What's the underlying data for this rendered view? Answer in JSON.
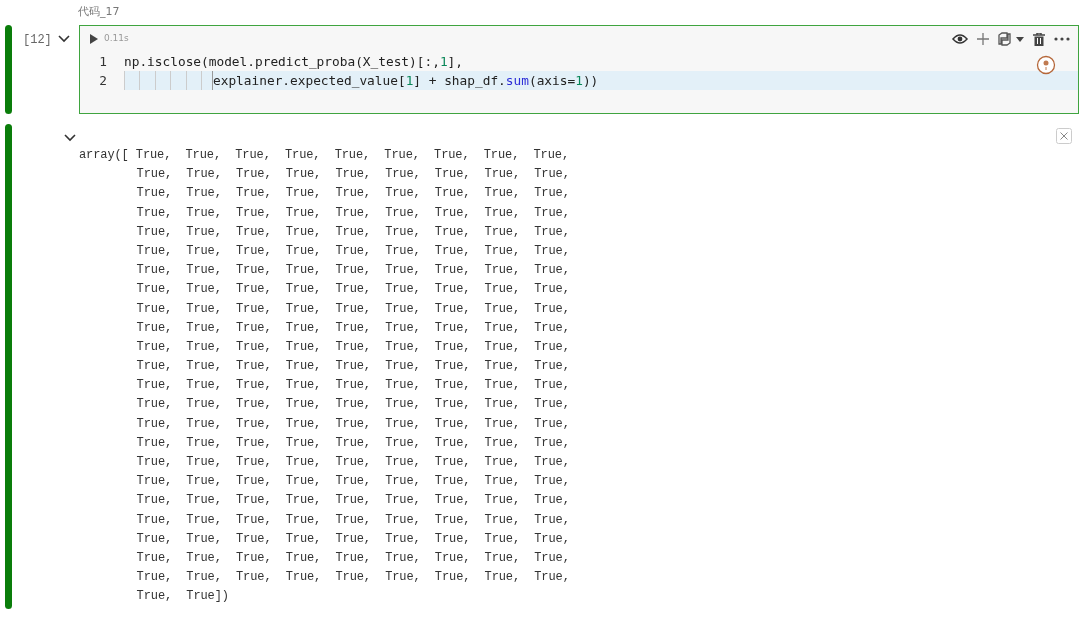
{
  "cell_title": "代码_17",
  "code_cell": {
    "execution_count": "[12]",
    "expanded": true,
    "run_time": "0.11s",
    "lines": [
      {
        "number": "1",
        "current": false,
        "tokens": [
          {
            "kind": "plain",
            "text": "np.isclose(model.predict_proba(X_test)[:,"
          },
          {
            "kind": "number",
            "text": "1"
          },
          {
            "kind": "plain",
            "text": "],"
          }
        ]
      },
      {
        "number": "2",
        "current": true,
        "indented": true,
        "tokens": [
          {
            "kind": "plain",
            "text": "explainer.expected_value["
          },
          {
            "kind": "number",
            "text": "1"
          },
          {
            "kind": "plain",
            "text": "] + shap_df."
          },
          {
            "kind": "function",
            "text": "sum"
          },
          {
            "kind": "plain",
            "text": "(axis="
          },
          {
            "kind": "number",
            "text": "1"
          },
          {
            "kind": "plain",
            "text": "))"
          }
        ]
      }
    ]
  },
  "output": {
    "expanded": true,
    "lines": [
      "array([ True,  True,  True,  True,  True,  True,  True,  True,  True,",
      "True,  True,  True,  True,  True,  True,  True,  True,  True,",
      "True,  True,  True,  True,  True,  True,  True,  True,  True,",
      "True,  True,  True,  True,  True,  True,  True,  True,  True,",
      "True,  True,  True,  True,  True,  True,  True,  True,  True,",
      "True,  True,  True,  True,  True,  True,  True,  True,  True,",
      "True,  True,  True,  True,  True,  True,  True,  True,  True,",
      "True,  True,  True,  True,  True,  True,  True,  True,  True,",
      "True,  True,  True,  True,  True,  True,  True,  True,  True,",
      "True,  True,  True,  True,  True,  True,  True,  True,  True,",
      "True,  True,  True,  True,  True,  True,  True,  True,  True,",
      "True,  True,  True,  True,  True,  True,  True,  True,  True,",
      "True,  True,  True,  True,  True,  True,  True,  True,  True,",
      "True,  True,  True,  True,  True,  True,  True,  True,  True,",
      "True,  True,  True,  True,  True,  True,  True,  True,  True,",
      "True,  True,  True,  True,  True,  True,  True,  True,  True,",
      "True,  True,  True,  True,  True,  True,  True,  True,  True,",
      "True,  True,  True,  True,  True,  True,  True,  True,  True,",
      "True,  True,  True,  True,  True,  True,  True,  True,  True,",
      "True,  True,  True,  True,  True,  True,  True,  True,  True,",
      "True,  True,  True,  True,  True,  True,  True,  True,  True,",
      "True,  True,  True,  True,  True,  True,  True,  True,  True,",
      "True,  True,  True,  True,  True,  True,  True,  True,  True,",
      "True,  True])"
    ]
  }
}
